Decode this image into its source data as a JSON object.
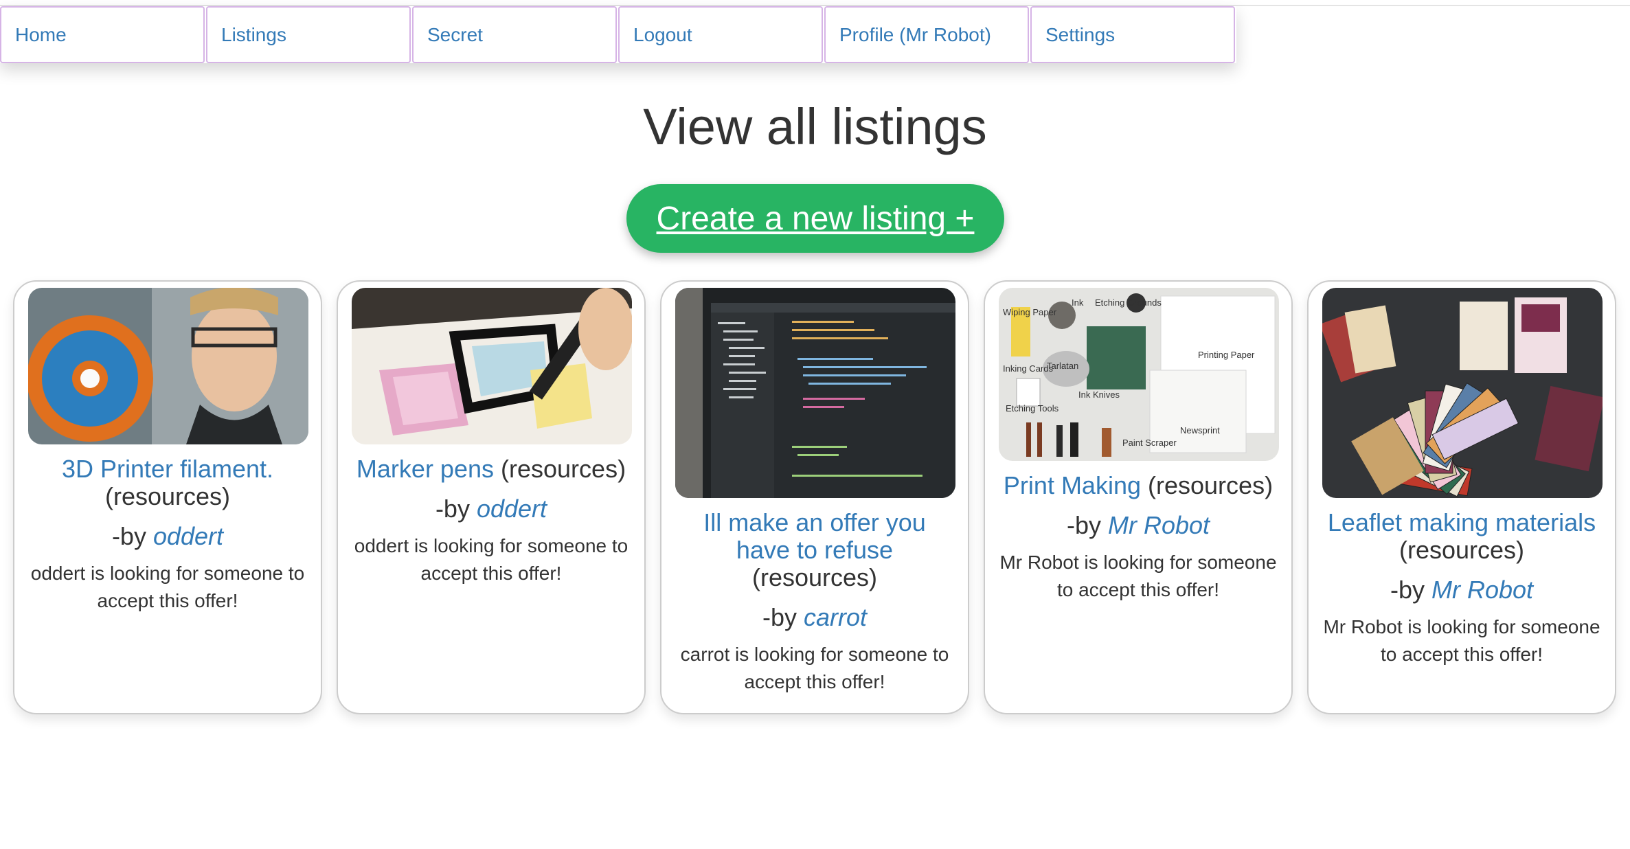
{
  "nav": [
    {
      "label": "Home"
    },
    {
      "label": "Listings"
    },
    {
      "label": "Secret"
    },
    {
      "label": "Logout"
    },
    {
      "label": "Profile (Mr Robot)"
    },
    {
      "label": "Settings"
    }
  ],
  "page": {
    "title": "View all listings",
    "create_button": "Create a new listing +"
  },
  "listings": [
    {
      "title": "3D Printer filament.",
      "category": "(resources)",
      "by_prefix": "-by",
      "author": "oddert",
      "description": "oddert is looking for someone to accept this offer!"
    },
    {
      "title": "Marker pens",
      "category": "(resources)",
      "by_prefix": "-by",
      "author": "oddert",
      "description": "oddert is looking for someone to accept this offer!"
    },
    {
      "title": "Ill make an offer you have to refuse",
      "category": "(resources)",
      "by_prefix": "-by",
      "author": "carrot",
      "description": "carrot is looking for someone to accept this offer!"
    },
    {
      "title": "Print Making",
      "category": "(resources)",
      "by_prefix": "-by",
      "author": "Mr Robot",
      "description": "Mr Robot is looking for someone to accept this offer!"
    },
    {
      "title": "Leaflet making materials",
      "category": "(resources)",
      "by_prefix": "-by",
      "author": "Mr Robot",
      "description": "Mr Robot is looking for someone to accept this offer!"
    }
  ],
  "photo_labels": {
    "print_making": [
      "Wiping Paper",
      "Ink",
      "Etching Grounds",
      "Printing Paper",
      "Inking Cards",
      "Tarlatan",
      "Etching Tools",
      "Ink Knives",
      "Paint Scraper",
      "Newsprint"
    ]
  },
  "colors": {
    "link": "#337ab7",
    "create_button": "#28b463",
    "nav_border": "#d6b4e6",
    "text": "#333333"
  }
}
